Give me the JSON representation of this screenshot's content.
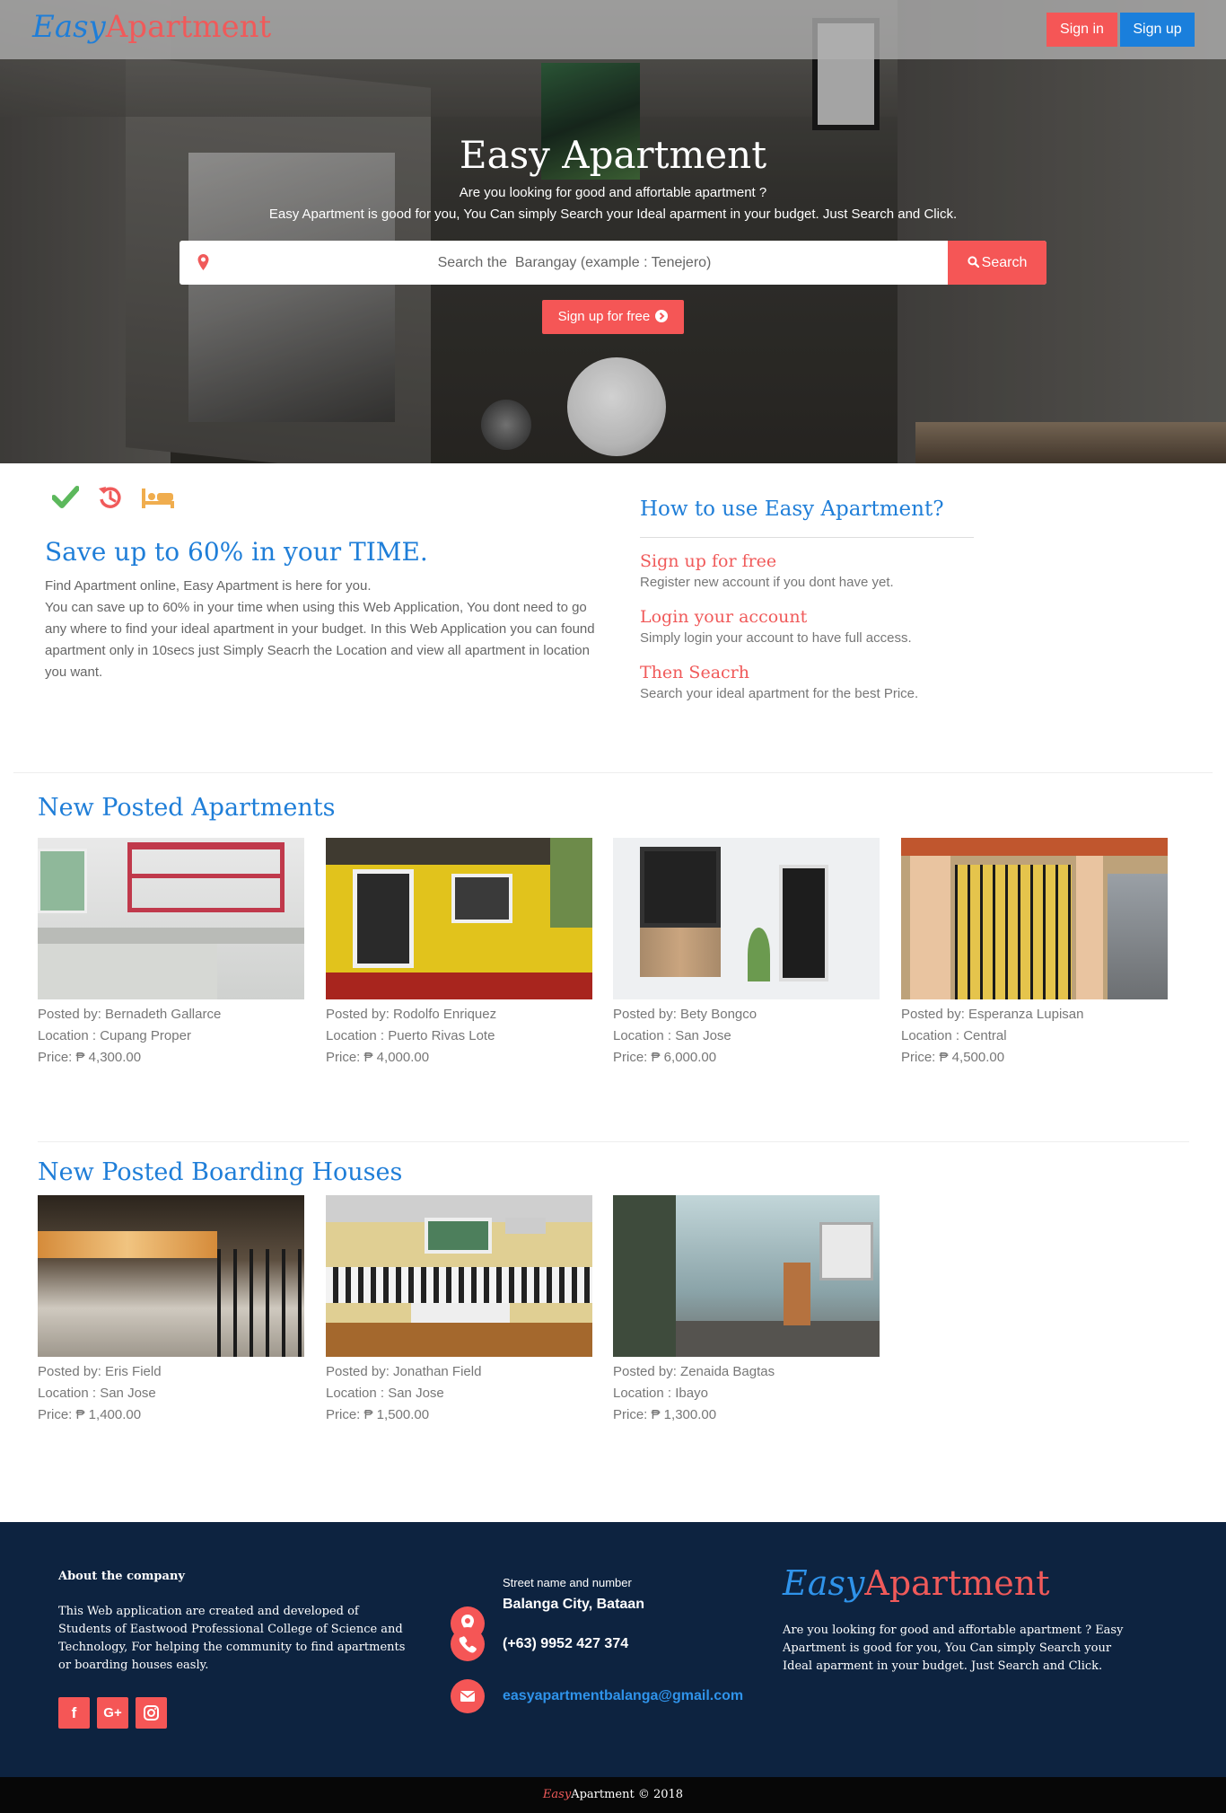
{
  "nav": {
    "brand_part1": "Easy",
    "brand_part2": "Apartment",
    "signin_label": "Sign in",
    "signup_label": "Sign up"
  },
  "hero": {
    "title": "Easy Apartment",
    "line1": "Are you looking for good and affortable apartment ?",
    "line2": "Easy Apartment is good for you, You Can simply Search your Ideal aparment in your budget. Just Search and Click.",
    "search_placeholder": "Search the  Barangay (example : Tenejero)",
    "search_button": "Search",
    "free_button": "Sign up for free"
  },
  "features": {
    "icons": [
      "check-icon",
      "history-icon",
      "bed-icon"
    ],
    "icon_colors": {
      "check": "#5cb85c",
      "history": "#f05a5a",
      "bed": "#f0ad4e"
    },
    "title": "Save up to 60% in your TIME.",
    "text_line1": "Find Apartment online, Easy Apartment is here for you.",
    "text_line2": "You can save up to 60% in your time when using this Web Application, You dont need to go any where to find your ideal apartment in your budget. In this Web Application you can found apartment only in 10secs just Simply Seacrh the Location and view all apartment in location you want."
  },
  "howto": {
    "title": "How to use Easy Apartment?",
    "steps": [
      {
        "title": "Sign up for free",
        "desc": "Register new account if you dont have yet."
      },
      {
        "title": "Login your account",
        "desc": "Simply login your account to have full access."
      },
      {
        "title": "Then Seacrh",
        "desc": "Search your ideal apartment for the best Price."
      }
    ]
  },
  "apartments": {
    "title": "New Posted Apartments",
    "items": [
      {
        "posted_by": "Posted by: Bernadeth Gallarce",
        "location": "Location : Cupang Proper",
        "price": "Price: ₱ 4,300.00"
      },
      {
        "posted_by": "Posted by: Rodolfo Enriquez",
        "location": "Location : Puerto Rivas Lote",
        "price": "Price: ₱ 4,000.00"
      },
      {
        "posted_by": "Posted by: Bety Bongco",
        "location": "Location : San Jose",
        "price": "Price: ₱ 6,000.00"
      },
      {
        "posted_by": "Posted by: Esperanza Lupisan",
        "location": "Location : Central",
        "price": "Price: ₱ 4,500.00"
      }
    ]
  },
  "boarding": {
    "title": "New Posted Boarding Houses",
    "items": [
      {
        "posted_by": "Posted by: Eris Field",
        "location": "Location : San Jose",
        "price": "Price: ₱ 1,400.00"
      },
      {
        "posted_by": "Posted by: Jonathan Field",
        "location": "Location : San Jose",
        "price": "Price: ₱ 1,500.00"
      },
      {
        "posted_by": "Posted by: Zenaida Bagtas",
        "location": "Location : Ibayo",
        "price": "Price: ₱ 1,300.00"
      }
    ]
  },
  "footer": {
    "about_heading": "About the company",
    "about_text": "This Web application are created and developed of Students of Eastwood Professional College of Science and Technology, For helping the community to find apartments or boarding houses easly.",
    "social_icons": [
      "facebook-icon",
      "google-plus-icon",
      "instagram-icon"
    ],
    "street_label": "Street name and number",
    "city": "Balanga City, Bataan",
    "phone": "(+63) 9952 427 374",
    "email": "easyapartmentbalanga@gmail.com",
    "brand_part1": "Easy",
    "brand_part2": "Apartment",
    "description": "Are you looking for good and affortable apartment ? Easy Apartment is good for you, You Can simply Search your Ideal aparment in your budget. Just Search and Click.",
    "copyright_part1": "Easy",
    "copyright_part2": "Apartment © 2018"
  },
  "colors": {
    "accent_red": "#f55656",
    "brand_blue": "#1f7ed8",
    "footer_bg": "#0d2340"
  }
}
